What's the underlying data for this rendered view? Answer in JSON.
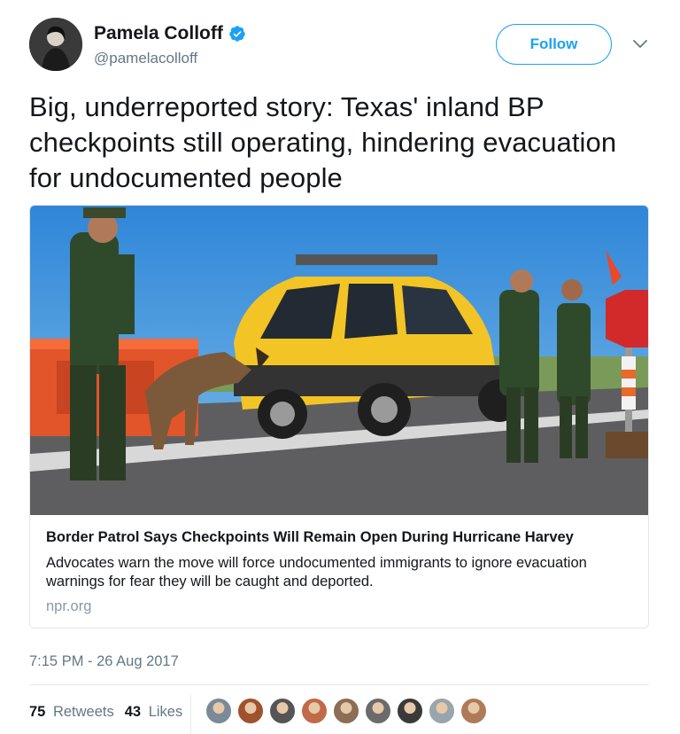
{
  "author": {
    "name": "Pamela Colloff",
    "handle": "@pamelacolloff",
    "verified": true,
    "avatar_icon": "user-avatar"
  },
  "actions": {
    "follow_label": "Follow",
    "menu_icon": "chevron-down-icon"
  },
  "tweet": {
    "text": "Big, underreported story: Texas' inland BP checkpoints still operating, hindering evacuation for undocumented people"
  },
  "card": {
    "title": "Border Patrol Says Checkpoints Will Remain Open During Hurricane Harvey",
    "description": "Advocates warn the move will force undocumented immigrants to ignore evacuation warnings for fear they will be caught and deported.",
    "domain": "npr.org",
    "image_icon": "news-photo"
  },
  "meta": {
    "timestamp": "7:15 PM - 26 Aug 2017"
  },
  "stats": {
    "retweets_count": "75",
    "retweets_label": "Retweets",
    "likes_count": "43",
    "likes_label": "Likes"
  },
  "likers": [
    {
      "color": "#7a8a99"
    },
    {
      "color": "#a0522d"
    },
    {
      "color": "#555555"
    },
    {
      "color": "#c06a4a"
    },
    {
      "color": "#8c6e54"
    },
    {
      "color": "#6b6b6b"
    },
    {
      "color": "#3a3a3a"
    },
    {
      "color": "#9aa4ad"
    },
    {
      "color": "#b07a5a"
    }
  ],
  "colors": {
    "accent": "#1da1f2",
    "text_primary": "#14171a",
    "text_secondary": "#657786"
  }
}
